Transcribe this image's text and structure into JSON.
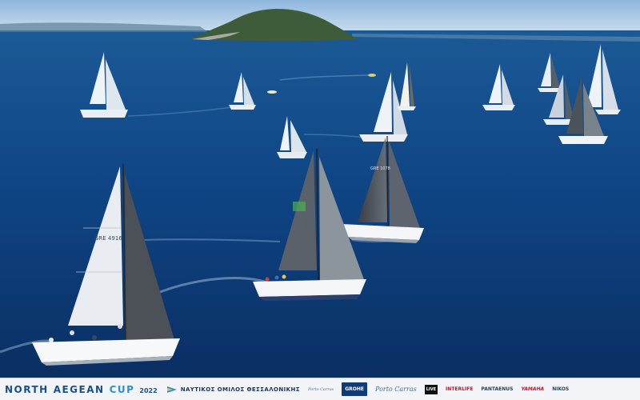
{
  "photo": {
    "boat_sail_numbers": [
      {
        "boat": "front-left",
        "text": "GRE 4916"
      },
      {
        "boat": "rear-center",
        "text": "GRE 1078"
      }
    ]
  },
  "banner": {
    "event_word1": "NORTH",
    "event_word2": "AEGEAN",
    "event_word3": "CUP",
    "event_year": "2022",
    "club_name": "ΝΑΥΤΙΚΟΣ ΟΜΙΛΟΣ ΘΕΣΣΑΛΟΝΙΚΗΣ",
    "sponsors": {
      "s1": "Porto Carras",
      "s2": "GROHE",
      "s3": "Porto Carras",
      "s4": "LIVE",
      "s5": "INTERLIFE",
      "s6": "PANTAENUS",
      "s7": "YAMAHA",
      "s8": "NIKOS"
    }
  }
}
